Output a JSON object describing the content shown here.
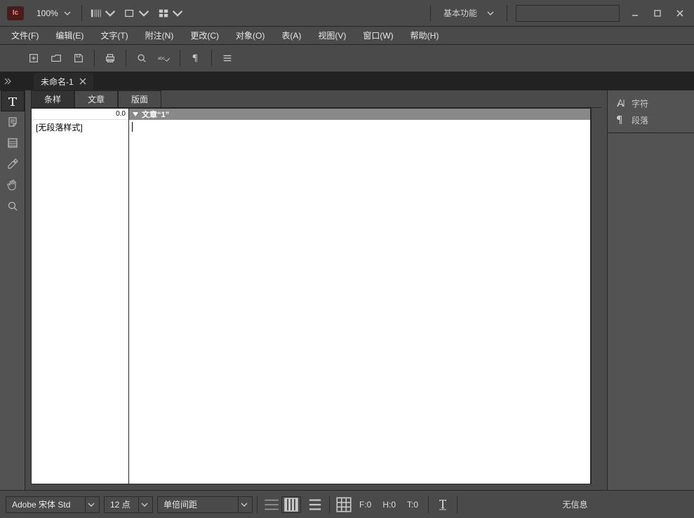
{
  "app": {
    "badge": "Ic",
    "zoom": "100%",
    "workspace": "基本功能"
  },
  "menu": {
    "items": [
      "文件(F)",
      "编辑(E)",
      "文字(T)",
      "附注(N)",
      "更改(C)",
      "对象(O)",
      "表(A)",
      "视图(V)",
      "窗口(W)",
      "帮助(H)"
    ]
  },
  "doc_tab": {
    "name": "未命名-1"
  },
  "sub_tabs": {
    "items": [
      "条样",
      "文章",
      "版面"
    ],
    "active_index": 0
  },
  "styles_panel": {
    "header_value": "0.0",
    "items": [
      "[无段落样式]"
    ]
  },
  "story": {
    "title": "文章“1”"
  },
  "right_panels": {
    "items": [
      {
        "icon": "char",
        "label": "字符"
      },
      {
        "icon": "para",
        "label": "段落"
      }
    ]
  },
  "bottom": {
    "font": "Adobe 宋体 Std",
    "size": "12 点",
    "leading": "单倍间距",
    "frame": {
      "f": "F:0",
      "h": "H:0",
      "t": "T:0"
    },
    "info": "无信息"
  }
}
